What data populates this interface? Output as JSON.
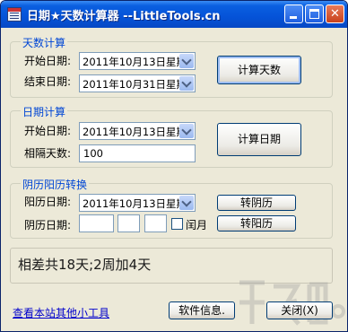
{
  "window": {
    "title": "日期★天数计算器 --LittleTools.cn"
  },
  "days_calc": {
    "group_title": "天数计算",
    "start_label": "开始日期:",
    "start_value": "2011年10月13日星期",
    "end_label": "结束日期:",
    "end_value": "2011年10月31日星期",
    "button_label": "计算天数"
  },
  "date_calc": {
    "group_title": "日期计算",
    "start_label": "开始日期:",
    "start_value": "2011年10月13日星期",
    "interval_label": "相隔天数:",
    "interval_value": "100",
    "button_label": "计算日期"
  },
  "lunar_convert": {
    "group_title": "阴历阳历转换",
    "solar_label": "阳历日期:",
    "solar_value": "2011年10月13日星期",
    "to_lunar_label": "转阴历",
    "lunar_label": "阴历日期:",
    "leap_label": "闰月",
    "to_solar_label": "转阳历"
  },
  "result": {
    "text": "相差共18天;2周加4天"
  },
  "footer": {
    "link_text": "查看本站其他小工具",
    "info_button": "软件信息.",
    "close_button": "关闭(X)"
  },
  "icons": [
    "app-calendar-icon",
    "minimize-icon",
    "maximize-icon",
    "close-icon",
    "chevron-down-icon"
  ],
  "colors": {
    "titlebar": "#0553d8",
    "group_title": "#0046d5",
    "link": "#0000cc",
    "window_bg": "#ece9d8"
  }
}
